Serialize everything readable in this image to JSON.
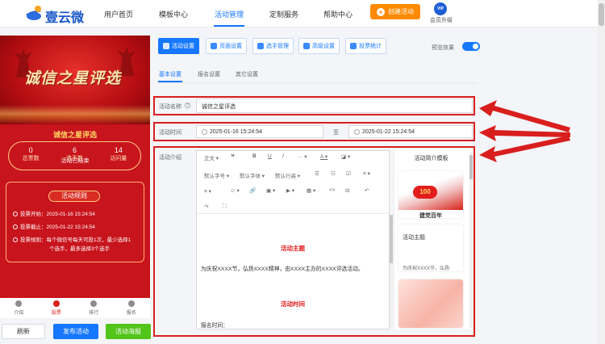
{
  "brand": {
    "name": "壹云微"
  },
  "nav": {
    "items": [
      "用户首页",
      "模板中心",
      "活动管理",
      "定制服务",
      "帮助中心"
    ],
    "create_label": "创建活动",
    "vip_badge": "VIP",
    "vip_label": "会员升级"
  },
  "preview": {
    "banner_title": "诚信之星评选",
    "activity_title": "诚信之星评选",
    "status": "活动已结束",
    "stats": [
      {
        "value": "0",
        "label": "总票数"
      },
      {
        "value": "6",
        "label": "选手数"
      },
      {
        "value": "14",
        "label": "访问量"
      }
    ],
    "rules_title": "活动规则",
    "rules": [
      "投票开始：2025-01-16 15:24:54",
      "投票截止：2025-01-22 15:24:54",
      "投票规则：每个微信号每天可投1次，最少选择1",
      "个选手，最多选择3个选手"
    ],
    "tabbar": [
      "介绍",
      "投票",
      "排行",
      "报名"
    ]
  },
  "bottom_buttons": {
    "refresh": "刷新",
    "publish": "发布活动",
    "poster": "活动海报"
  },
  "toolbar": {
    "buttons": [
      "活动设置",
      "页面设置",
      "选手管理",
      "高级设置",
      "投票统计"
    ],
    "preview_label": "预览效果"
  },
  "subtabs": [
    "基本设置",
    "报名设置",
    "其它设置"
  ],
  "form": {
    "name_label": "活动名称",
    "name_value": "诚信之星评选",
    "time_label": "活动时间",
    "start_time": "2025-01-16 15:24:54",
    "separator": "至",
    "end_time": "2025-01-22 15:24:54",
    "intro_label": "活动介绍"
  },
  "editor": {
    "toolbar_row1": [
      "正文",
      "❝",
      "B",
      "U",
      "I",
      "···",
      "A",
      "◪"
    ],
    "toolbar_row2": [
      "默认字号",
      "默认字体",
      "默认行高",
      "☰",
      "☷",
      "☑",
      "≡"
    ],
    "toolbar_row3": [
      "≡",
      "☺",
      "🔗",
      "▣",
      "▶",
      "▦",
      "<>",
      "⊟",
      "↶"
    ],
    "toolbar_row4": [
      "↷",
      "⛶"
    ],
    "heading1": "活动主题",
    "paragraph1": "为庆祝XXXX节，弘扬XXXX精神，由XXXX主办的XXXX评选活动。",
    "heading2": "活动时间",
    "paragraph2": "报名时间："
  },
  "templates": {
    "title": "活动简介模板",
    "card1_caption": "建党百年",
    "card2_title": "活动主题",
    "card2_snippet": "为庆祝XXXX节，弘扬"
  }
}
